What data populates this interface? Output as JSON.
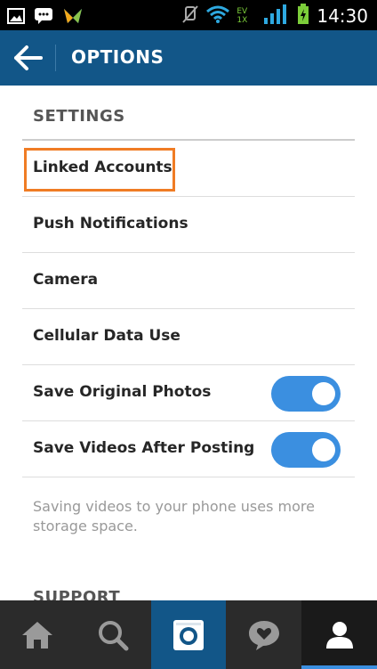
{
  "status_bar": {
    "time": "14:30",
    "network_label": "EV 1X",
    "icons": [
      "image-icon",
      "chat-icon",
      "app-icon",
      "mute-icon",
      "wifi-icon",
      "signal-icon",
      "battery-icon"
    ]
  },
  "header": {
    "title": "OPTIONS",
    "back_icon": "back-arrow-icon"
  },
  "settings": {
    "title": "SETTINGS",
    "items": [
      {
        "label": "Linked Accounts",
        "highlighted": true
      },
      {
        "label": "Push Notifications"
      },
      {
        "label": "Camera"
      },
      {
        "label": "Cellular Data Use"
      },
      {
        "label": "Save Original Photos",
        "toggle": true,
        "on": true
      },
      {
        "label": "Save Videos After Posting",
        "toggle": true,
        "on": true
      }
    ],
    "note": "Saving videos to your phone uses more storage space."
  },
  "support": {
    "title": "SUPPORT"
  },
  "bottom_nav": {
    "items": [
      {
        "icon": "home-icon"
      },
      {
        "icon": "search-icon"
      },
      {
        "icon": "camera-icon",
        "active_color": "#125688"
      },
      {
        "icon": "activity-heart-icon"
      },
      {
        "icon": "profile-icon",
        "selected": true
      }
    ]
  },
  "colors": {
    "header_bg": "#125688",
    "toggle_on": "#3b8fe0",
    "highlight": "#f07c24",
    "nav_bg": "#2b2b2b"
  }
}
